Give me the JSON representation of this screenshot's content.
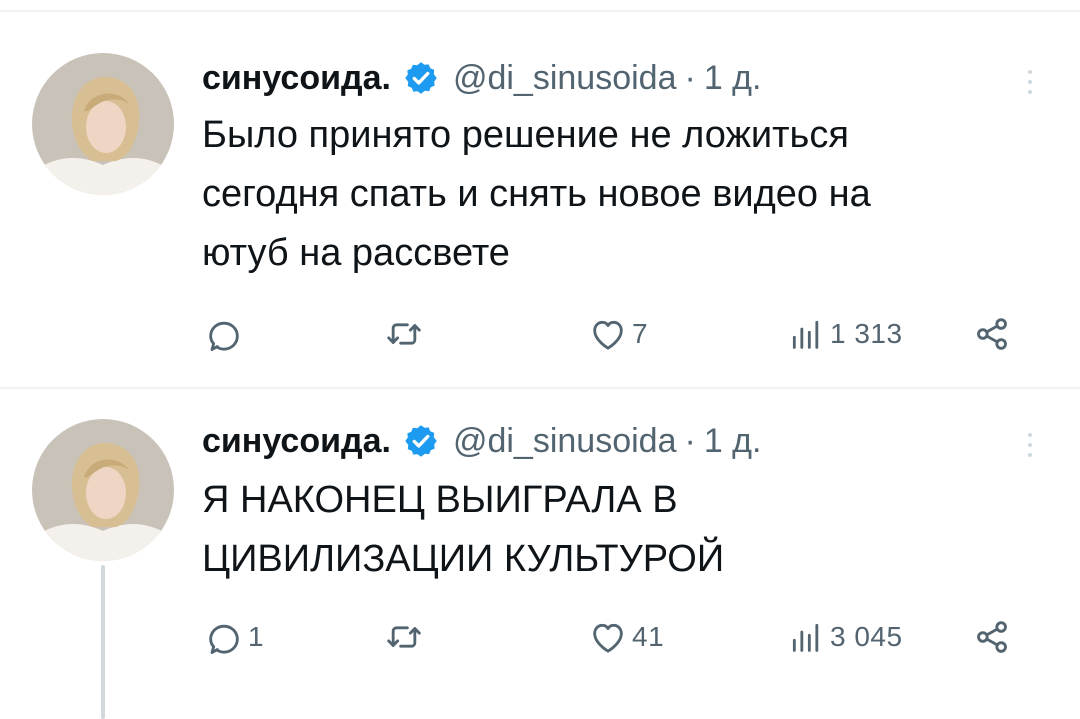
{
  "tweets": [
    {
      "author": {
        "name": "синусоида.",
        "handle": "@di_sinusoida",
        "verified": true
      },
      "separator": "·",
      "time": "1 д.",
      "text": "Было принято решение не ложиться\nсегодня спать и снять новое видео на\nютуб на рассвете",
      "stats": {
        "replies": "",
        "retweets": "",
        "likes": "7",
        "views": "1 313"
      }
    },
    {
      "author": {
        "name": "синусоида.",
        "handle": "@di_sinusoida",
        "verified": true
      },
      "separator": "·",
      "time": "1 д.",
      "text": "Я НАКОНЕЦ ВЫИГРАЛА В\nЦИВИЛИЗАЦИИ КУЛЬТУРОЙ",
      "stats": {
        "replies": "1",
        "retweets": "",
        "likes": "41",
        "views": "3 045"
      }
    }
  ],
  "colors": {
    "verified_blue": "#1d9bf0",
    "secondary_text": "#536471",
    "divider": "#eff3f4",
    "thread_line": "#cfd9de"
  },
  "icons": [
    "verified-icon",
    "more-icon",
    "reply-icon",
    "retweet-icon",
    "like-icon",
    "views-icon",
    "share-icon"
  ]
}
